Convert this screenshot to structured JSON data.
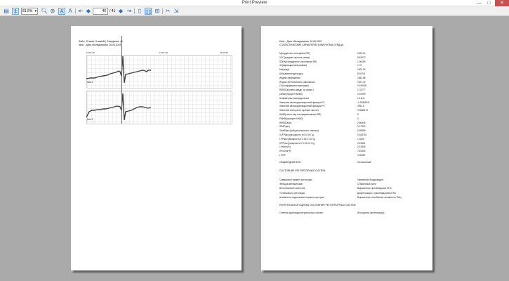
{
  "window": {
    "title": "Print Preview",
    "minimize": "—",
    "maximize": "□",
    "close": "✕"
  },
  "toolbar": {
    "zoom_value": "81,5%",
    "page_current": "40",
    "page_total": "/ 41",
    "accent": "#2f6fb5",
    "icons": [
      "page-setup-icon",
      "zoom-in-icon",
      "zoom-out-icon",
      "text-cursor-icon",
      "text-size-icon",
      "first-page-icon",
      "prev-page-icon",
      "next-page-icon",
      "last-page-icon",
      "one-page-icon",
      "two-pages-icon",
      "four-pages-icon",
      "cut-icon",
      "export-icon"
    ]
  },
  "page1": {
    "header_line1": "Файл: 20 мм/с, 5 мм/мВ | Отведения: 40",
    "header_line2": "Имя:  - Дата обследования: 26.06.2015",
    "time_left": "15:01:46",
    "time_mid": "15:01:48",
    "time_right": "15:01:50",
    "lead1_label": "Кан 1",
    "lead2_label": "Кан 2"
  },
  "page2": {
    "header_line1": "Имя:  - Дата обследования: 26.06.2015",
    "header_line2": "СТАТИСТИЧЕСКИЕ ХАРАКТЕРИСТИКИ РИТМА СЕРДЦА",
    "stats": [
      {
        "k": "M[сердечного интервала RR]",
        "v": "1000.04"
      },
      {
        "k": "ЧСС(средняя частота ритма)",
        "v": "59.9972"
      },
      {
        "k": "SDNN(стандартное отклонение RR)",
        "v": "1.96159"
      },
      {
        "k": "dX(вариационный размах)",
        "v": "17.5"
      },
      {
        "k": "Mo(мода)",
        "v": "1000.04"
      },
      {
        "k": "AMo(амплитуда моды)",
        "v": "82.6741"
      },
      {
        "k": "Индекс напряжения",
        "v": "2363.58"
      },
      {
        "k": "Индекс вегетативного равновесия",
        "v": "7021.42"
      },
      {
        "k": "CV(коэффициент вариации)",
        "v": "0.196155"
      },
      {
        "k": "RMSSD(корень квадр. из средн.)",
        "v": "17.8777"
      },
      {
        "k": "pNN50(процент NN50)",
        "v": "10.9099"
      },
      {
        "k": "Асимметрия распределения",
        "v": "1.11111"
      },
      {
        "k": "Значение автокорреляционной функции P1",
        "v": "-0.00355311"
      },
      {
        "k": "Значение автокорреляционной функции P2",
        "v": "2952.6"
      },
      {
        "k": "Значение спектра на нулевой частоте",
        "v": "0.0688174"
      },
      {
        "k": "NN50(число пар последовательных RR)",
        "v": "0"
      },
      {
        "k": "PNN50(процент NN50)",
        "v": "0"
      },
      {
        "k": "RMSSD(мс)",
        "v": "2.86346"
      },
      {
        "k": "SDSD(мс)",
        "v": "2.27392"
      },
      {
        "k": "TotalP(мс²)(общая мощность спектра)",
        "v": "5.90899"
      },
      {
        "k": "VLFP(мс²)(мощность в 0-0.04 Гц)",
        "v": "0.166781"
      },
      {
        "k": "LFP(мс²)(мощность в 0.04-0.15 Гц)",
        "v": "1.3526"
      },
      {
        "k": "HFP(мс²)(мощность в 0.15-0.4 Гц)",
        "v": "4.91561"
      },
      {
        "k": "LFnorm(%)",
        "v": "23.4836"
      },
      {
        "k": "HFnorm(%)",
        "v": "76.5304"
      },
      {
        "k": "LF/HF",
        "v": "0.30687"
      }
    ],
    "general_label": "ОБЩИЙ ДИАГНОЗ:",
    "general_value": "Нетипичный",
    "reg_title": "СОСТОЯНИЕ РЕГУЛЯТОРНЫХ СИСТЕМ",
    "reg": [
      {
        "k": "Суммарный эффект регуляции:",
        "v": "Умеренная брадикардия"
      },
      {
        "k": "Функция автоматизма:",
        "v": "Стабильный ритм"
      },
      {
        "k": "Вегетативный гомеостаз:",
        "v": "Выраженное преобладание ПНС"
      },
      {
        "k": "Устойчивость регуляции:",
        "v": "Дисрегуляция с преобладанием ПНС"
      },
      {
        "k": "Активность подкорковых нервных центров:",
        "v": "Выраженное ослабление активности ПАЦ"
      }
    ],
    "integral_title": "ИНТЕГРАЛЬНАЯ ОЦЕНКА СОСТОЯНИЯ РЕГУЛЯТОРНЫХ СИСТЕМ",
    "integral": [
      {
        "k": "Степень адаптации регуляторных систем:",
        "v": "Истощение (астенизация)"
      }
    ]
  }
}
